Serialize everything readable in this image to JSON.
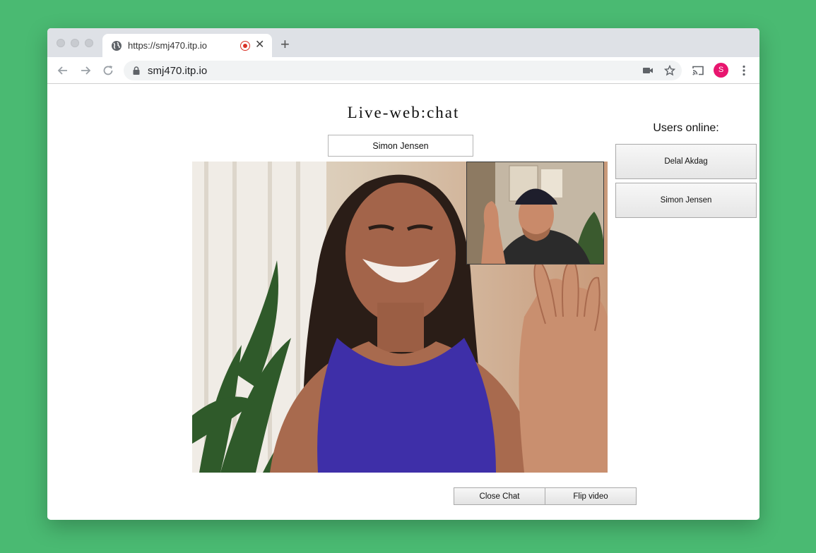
{
  "browser": {
    "tab": {
      "title": "https://smj470.itp.io",
      "favicon": "globe-icon",
      "recording_color": "#d93025"
    },
    "url": "smj470.itp.io",
    "avatar_letter": "S",
    "avatar_color": "#e8166f"
  },
  "page": {
    "title": "Live-web:chat",
    "name_input_value": "Simon Jensen",
    "users_heading": "Users online:",
    "users": [
      "Delal Akdag",
      "Simon Jensen"
    ],
    "buttons": {
      "close_chat": "Close Chat",
      "flip_video": "Flip video"
    }
  },
  "colors": {
    "background": "#4aba72",
    "tank_top": "#3e2fa8"
  }
}
